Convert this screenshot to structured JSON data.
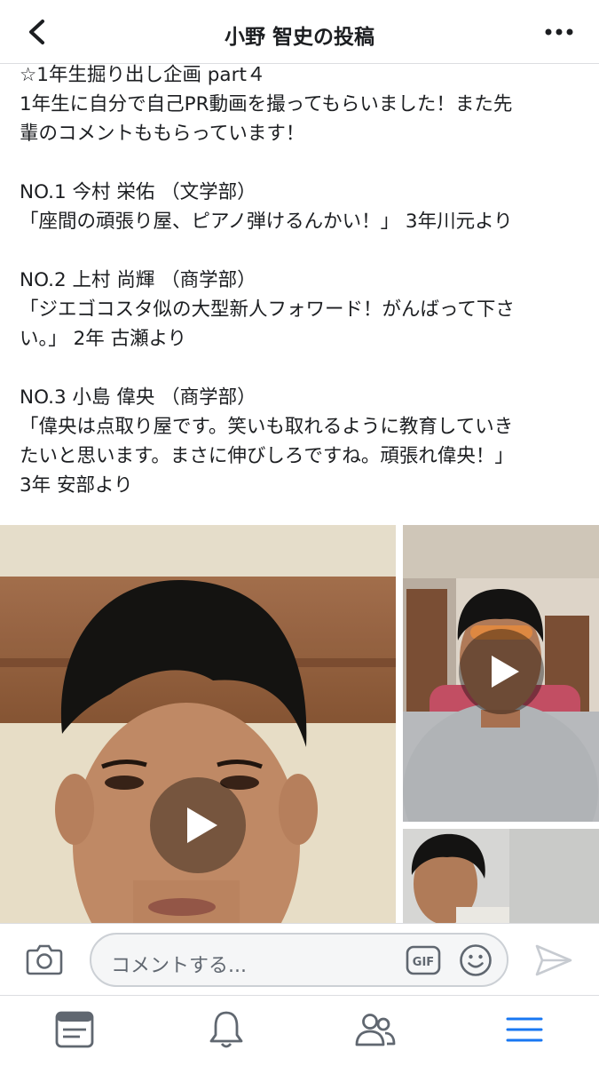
{
  "header": {
    "title": "小野 智史の投稿",
    "back_icon": "chevron-left-icon",
    "more_icon": "more-horizontal-icon"
  },
  "post": {
    "lines": [
      "☆1年生掘り出し企画 part４",
      "1年生に自分で自己PR動画を撮ってもらいました！また先",
      "輩のコメントももらっています！",
      "",
      "NO.1 今村 栄佑 （文学部）",
      "「座間の頑張り屋、ピアノ弾けるんかい！」 3年川元より",
      "",
      "NO.2 上村 尚輝 （商学部）",
      "「ジエゴコスタ似の大型新人フォワード！がんばって下さ",
      "い。」 2年 古瀬より",
      "",
      "NO.3 小島 偉央 （商学部）",
      "「偉央は点取り屋です。笑いも取れるように教育していき",
      "たいと思います。まさに伸びしろですね。頑張れ偉央！」",
      "3年 安部より"
    ]
  },
  "media": {
    "videos": [
      {
        "name": "video-1",
        "icon": "play-icon"
      },
      {
        "name": "video-2",
        "icon": "play-icon"
      },
      {
        "name": "video-3",
        "icon": ""
      }
    ]
  },
  "comment_bar": {
    "placeholder": "コメントする...",
    "gif_label": "GIF",
    "camera_icon": "camera-icon",
    "emoji_icon": "smiley-icon",
    "send_icon": "send-icon"
  },
  "tab_bar": {
    "items": [
      {
        "name": "news-feed",
        "icon": "news-feed-icon",
        "active": false
      },
      {
        "name": "notifications",
        "icon": "bell-icon",
        "active": false
      },
      {
        "name": "friends",
        "icon": "friends-icon",
        "active": false
      },
      {
        "name": "menu",
        "icon": "menu-icon",
        "active": true
      }
    ]
  },
  "colors": {
    "accent": "#1877f2",
    "icon_gray": "#606770",
    "text": "#1c1e21",
    "divider": "#dcdde1",
    "input_bg": "#f5f6f7"
  }
}
